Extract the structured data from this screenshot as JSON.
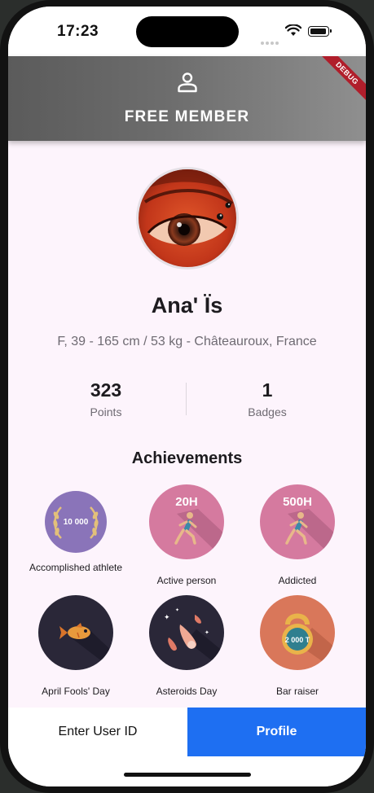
{
  "status_bar": {
    "time": "17:23"
  },
  "header": {
    "title": "FREE MEMBER",
    "debug_banner": "DEBUG"
  },
  "profile": {
    "name": "Ana' Ïs",
    "info": "F, 39 - 165 cm / 53 kg - Châteauroux, France"
  },
  "stats": {
    "points_value": "323",
    "points_label": "Points",
    "badges_value": "1",
    "badges_label": "Badges"
  },
  "achievements": {
    "title": "Achievements",
    "items": [
      {
        "label": "Accomplished athlete",
        "icon_text": "10 000",
        "color": "#8a74b9"
      },
      {
        "label": "Active person",
        "icon_text": "20H",
        "color": "#d57a9f"
      },
      {
        "label": "Addicted",
        "icon_text": "500H",
        "color": "#d57a9f"
      },
      {
        "label": "April Fools' Day",
        "icon_text": "",
        "color": "#2a2738"
      },
      {
        "label": "Asteroids Day",
        "icon_text": "",
        "color": "#2a2738"
      },
      {
        "label": "Bar raiser",
        "icon_text": "2 000 T",
        "color": "#d9775a"
      }
    ]
  },
  "bottom_nav": {
    "enter_user_id": "Enter User ID",
    "profile": "Profile"
  },
  "colors": {
    "accent": "#1e6ff2",
    "appbar": "#6d6d6d"
  }
}
